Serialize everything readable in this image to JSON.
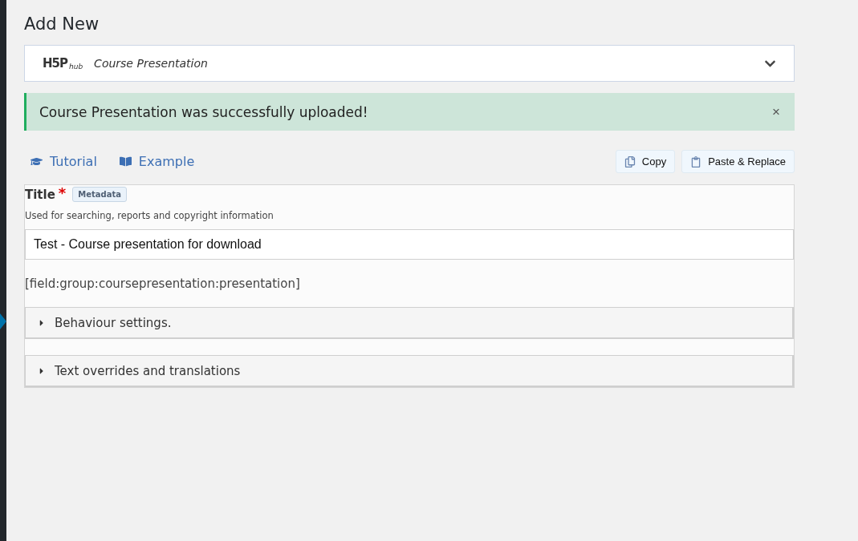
{
  "heading": "Add New",
  "hub": {
    "logo": "H5P",
    "logo_sub": "hub",
    "content_type": "Course Presentation",
    "expanded": false
  },
  "notice": {
    "message": "Course Presentation was successfully uploaded!",
    "close": "×"
  },
  "links": [
    {
      "kind": "tutorial",
      "label": "Tutorial"
    },
    {
      "kind": "example",
      "label": "Example"
    }
  ],
  "actions": [
    {
      "kind": "copy",
      "label": "Copy"
    },
    {
      "kind": "paste",
      "label": "Paste & Replace"
    }
  ],
  "title_field": {
    "label": "Title",
    "required_mark": "*",
    "metadata": "Metadata",
    "description": "Used for searching, reports and copyright information",
    "value": "Test - Course presentation for download"
  },
  "placeholder_text": "[field:group:coursepresentation:presentation]",
  "groups": [
    {
      "label": "Behaviour settings.",
      "expanded": false
    },
    {
      "label": "Text overrides and translations",
      "expanded": false
    }
  ]
}
